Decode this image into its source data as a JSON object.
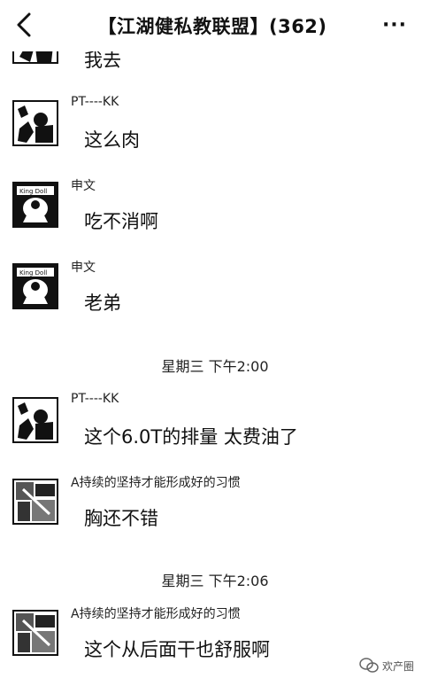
{
  "header": {
    "back_icon": "chevron-left-icon",
    "title": "【江湖健私教联盟】(362)",
    "more_label": "···"
  },
  "messages": [
    {
      "sender": "",
      "text": "我去",
      "avatar": "pt-kk-avatar"
    },
    {
      "sender": "PT----KK",
      "text": "这么肉",
      "avatar": "pt-kk-avatar"
    },
    {
      "sender": "申文",
      "text": "吃不消啊",
      "avatar": "shenwen-avatar"
    },
    {
      "sender": "申文",
      "text": "老弟",
      "avatar": "shenwen-avatar"
    },
    {
      "sender": "PT----KK",
      "text": "这个6.0T的排量 太费油了",
      "avatar": "pt-kk-avatar"
    },
    {
      "sender": "A持续的坚持才能形成好的习惯",
      "text": "胸还不错",
      "avatar": "photo-avatar"
    },
    {
      "sender": "A持续的坚持才能形成好的习惯",
      "text": "这个从后面干也舒服啊",
      "avatar": "photo-avatar"
    }
  ],
  "timestamps": [
    "星期三 下午2:00",
    "星期三 下午2:06"
  ],
  "watermark": {
    "text": "欢产圈",
    "icon": "wechat-icon"
  },
  "colors": {
    "text": "#111111",
    "background": "#ffffff"
  }
}
